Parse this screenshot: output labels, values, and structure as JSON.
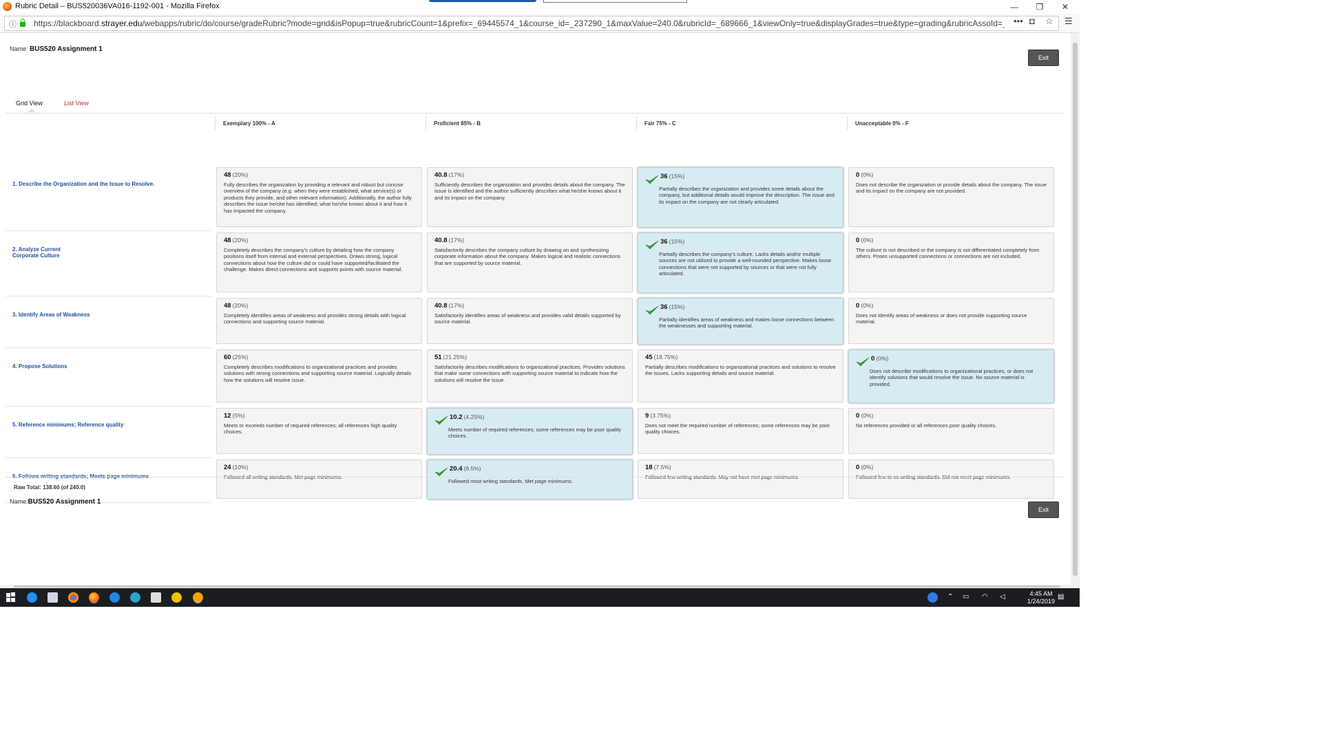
{
  "window": {
    "title": "Rubric Detail – BUS520036VA016-1192-001 - Mozilla Firefox",
    "minimize": "—",
    "restore": "❐",
    "close": "✕"
  },
  "urlbar": {
    "url_prefix": "https://blackboard.",
    "url_domain": "strayer.edu",
    "url_path": "/webapps/rubric/do/course/gradeRubric?mode=grid&isPopup=true&rubricCount=1&prefix=_69445574_1&course_id=_237290_1&maxValue=240.0&rubricId=_689666_1&viewOnly=true&displayGrades=true&type=grading&rubricAssoId=_826756_1"
  },
  "header": {
    "name_label": "Name:",
    "name_value": "BUS520 Assignment 1",
    "exit_label": "Exit"
  },
  "tabs": {
    "grid": "Grid View",
    "list": "List View"
  },
  "columns": [
    "Exemplary 100% - A",
    "Proficient 85% - B",
    "Fair 75% - C",
    "Unacceptable 0% - F"
  ],
  "rows": [
    {
      "label": "1. Describe the Organization and the Issue to Resolve.",
      "cells": [
        {
          "points": "48",
          "pct": "(20%)",
          "desc": "Fully describes the organization by providing a relevant and robust but concise overview of the company (e.g. when they were established, what service(s) or products they provide, and other relevant information). Additionally, the author fully describes the issue he/she has identified; what he/she knows about it and how it has impacted the company."
        },
        {
          "points": "40.8",
          "pct": "(17%)",
          "desc": "Sufficiently describes the organization and provides details about the company. The issue is identified and the author sufficiently describes what he/she knows about it and its impact on the company."
        },
        {
          "points": "36",
          "pct": "(15%)",
          "desc": "Partially describes the organization and provides some details about the company, but additional details would improve the description. The issue and its impact on the company are not clearly articulated."
        },
        {
          "points": "0",
          "pct": "(0%)",
          "desc": "Does not describe the organization or provide details about the company. The issue and its impact on the company are not provided."
        }
      ]
    },
    {
      "label": "2. Analyze Current Corporate Culture",
      "cells": [
        {
          "points": "48",
          "pct": "(20%)",
          "desc": "Completely describes the company's culture by detailing how the company positions itself from internal and external perspectives. Draws strong, logical connections about how the culture did or could have supported/facilitated the challenge. Makes direct connections and supports points with source material."
        },
        {
          "points": "40.8",
          "pct": "(17%)",
          "desc": "Satisfactorily describes the company culture by drawing on and synthesizing corporate information about the company. Makes logical and realistic connections that are supported by source material."
        },
        {
          "points": "36",
          "pct": "(15%)",
          "desc": "Partially describes the company's culture. Lacks details and/or multiple sources are not utilized to provide a well-rounded perspective. Makes loose connections that were not supported by sources or that were not fully articulated."
        },
        {
          "points": "0",
          "pct": "(0%)",
          "desc": "The culture is not described or the company is not differentiated completely from others. Poses unsupported connections or connections are not included."
        }
      ]
    },
    {
      "label": "3. Identify Areas of Weakness",
      "cells": [
        {
          "points": "48",
          "pct": "(20%)",
          "desc": "Completely identifies areas of weakness and provides strong details with logical connections and supporting source material."
        },
        {
          "points": "40.8",
          "pct": "(17%)",
          "desc": "Satisfactorily identifies areas of weakness and provides valid details supported by source material."
        },
        {
          "points": "36",
          "pct": "(15%)",
          "desc": "Partially identifies areas of weakness and makes loose connections between the weaknesses and supporting material."
        },
        {
          "points": "0",
          "pct": "(0%)",
          "desc": "Does not identify areas of weakness or does not provide supporting source material."
        }
      ]
    },
    {
      "label": "4. Propose Solutions",
      "cells": [
        {
          "points": "60",
          "pct": "(25%)",
          "desc": "Completely describes modifications to organizational practices and provides solutions with strong connections and supporting source material. Logically details how the solutions will resolve issue."
        },
        {
          "points": "51",
          "pct": "(21.25%)",
          "desc": "Satisfactorily describes modifications to organizational practices. Provides solutions that make some connections with supporting source material to indicate how the solutions will resolve the issue."
        },
        {
          "points": "45",
          "pct": "(18.75%)",
          "desc": "Partially describes modifications to organizational practices and solutions to resolve the issues. Lacks supporting details and source material."
        },
        {
          "points": "0",
          "pct": "(0%)",
          "desc": "Does not describe modifications to organizational practices, or does not identify solutions that would resolve the issue. No source material is provided."
        }
      ]
    },
    {
      "label": "5. Reference minimums; Reference quality",
      "cells": [
        {
          "points": "12",
          "pct": "(5%)",
          "desc": "Meets or exceeds number of required references; all references high quality choices."
        },
        {
          "points": "10.2",
          "pct": "(4.25%)",
          "desc": "Meets number of required references; some references may be poor quality choices."
        },
        {
          "points": "9",
          "pct": "(3.75%)",
          "desc": "Does not meet the required number of references; some references may be poor quality choices."
        },
        {
          "points": "0",
          "pct": "(0%)",
          "desc": "No references provided or all references poor quality choices."
        }
      ]
    },
    {
      "label": "6. Follows writing standards; Meets page minimums",
      "cells": [
        {
          "points": "24",
          "pct": "(10%)",
          "desc": "Followed all writing standards. Met page minimums."
        },
        {
          "points": "20.4",
          "pct": "(8.5%)",
          "desc": "Followed most writing standards. Met page minimums."
        },
        {
          "points": "18",
          "pct": "(7.5%)",
          "desc": "Followed few writing standards. May not have met page minimums."
        },
        {
          "points": "0",
          "pct": "(0%)",
          "desc": "Followed few to no writing standards. Did not meet page minimums."
        }
      ]
    }
  ],
  "selected": [
    2,
    2,
    2,
    3,
    1,
    1
  ],
  "footer": {
    "raw_total": "Raw Total: 138.60 (of 240.0)",
    "name_label": "Name:",
    "name_value": "BUS520 Assignment 1",
    "exit_label": "Exit"
  },
  "taskbar": {
    "time": "4:45 AM",
    "date": "1/24/2019"
  },
  "colors": {
    "selected_bg": "#d7ecf2",
    "link_red": "#c0282d",
    "row_label_blue": "#1f4e99",
    "check_green": "#3aa62c"
  }
}
